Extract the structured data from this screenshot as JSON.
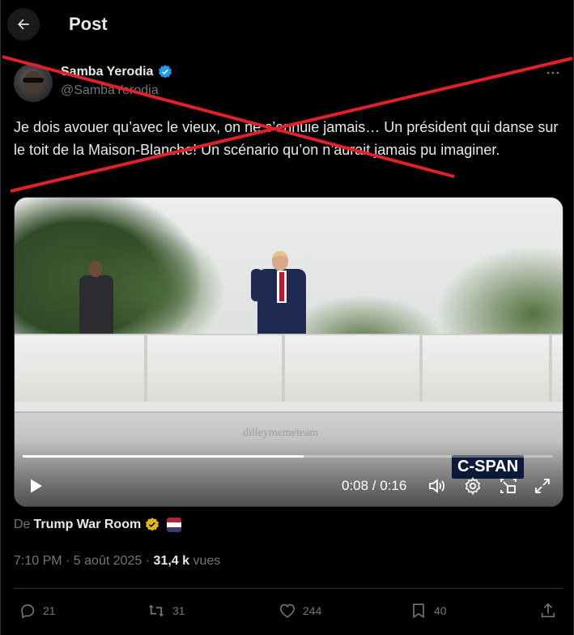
{
  "header": {
    "title": "Post"
  },
  "author": {
    "name": "Samba Yerodia",
    "handle": "@SambaYerodia"
  },
  "tweet": {
    "text": "Je dois avouer qu’avec le vieux, on ne s’ennuie jamais… Un président qui danse sur le toit de la Maison-Blanche! Un scénario qu’on n’aurait jamais pu imaginer."
  },
  "video": {
    "watermark": "dilleymemeteam",
    "broadcaster": "C-SPAN",
    "time": "0:08 / 0:16",
    "progress": 0.53
  },
  "source": {
    "prefix": "De",
    "name": "Trump War Room"
  },
  "meta": {
    "time": "7:10 PM · 5 août 2025 · ",
    "views_count": "31,4 k",
    "views_label": " vues"
  },
  "actions": {
    "replies": "21",
    "reposts": "31",
    "likes": "244",
    "bookmarks": "40"
  },
  "colors": {
    "verified_blue": "#1d9bf0",
    "verified_gold": "#e2b719",
    "cross_red": "#e0202a"
  },
  "icons": [
    "back-arrow-icon",
    "verified-badge-icon",
    "more-icon",
    "play-icon",
    "volume-icon",
    "settings-icon",
    "pip-icon",
    "fullscreen-icon",
    "reply-icon",
    "repost-icon",
    "like-icon",
    "bookmark-icon",
    "share-icon",
    "flag-icon"
  ]
}
